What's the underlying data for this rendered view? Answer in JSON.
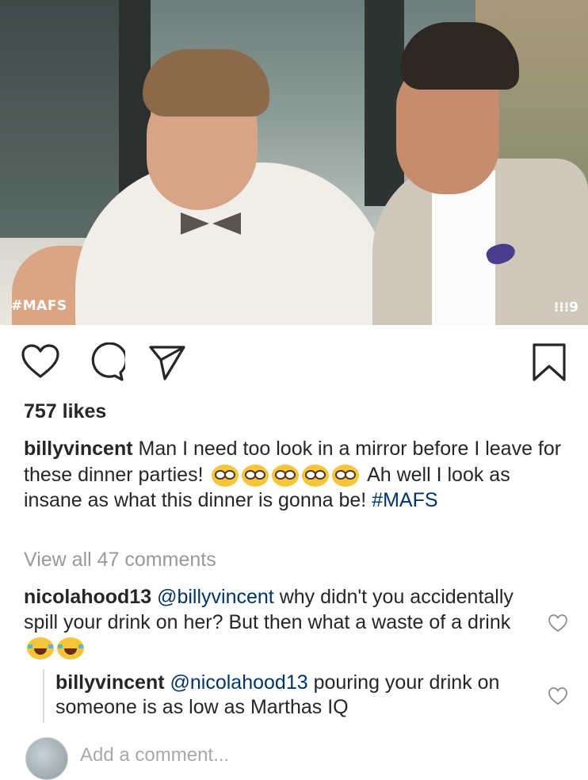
{
  "media": {
    "overlay_hashtag": "#MAFS",
    "network_logo": "⁝⁝⁝9"
  },
  "actions": {
    "like_icon": "heart-icon",
    "comment_icon": "comment-icon",
    "share_icon": "share-icon",
    "save_icon": "bookmark-icon"
  },
  "likes": "757 likes",
  "caption": {
    "username": "billyvincent",
    "text_before_emoji": "Man I need too look in a mirror before I leave for these dinner parties!",
    "emoji_count": 5,
    "text_after_emoji": "Ah well I look as insane as what this dinner is gonna be!",
    "hashtag": "#MAFS"
  },
  "view_all_comments": "View all 47 comments",
  "comments": [
    {
      "username": "nicolahood13",
      "mention": "@billyvincent",
      "text": "why didn't you accidentally spill your drink on her? But then what a waste of a drink",
      "emoji": "laughing-tears",
      "emoji_count": 2
    }
  ],
  "reply": {
    "username": "billyvincent",
    "mention": "@nicolahood13",
    "text": "pouring your drink on someone is as low as Marthas IQ"
  },
  "add_comment": {
    "placeholder": "Add a comment..."
  },
  "colors": {
    "text": "#262626",
    "muted": "#999999",
    "link": "#003569",
    "divider": "#dbdbdb"
  }
}
